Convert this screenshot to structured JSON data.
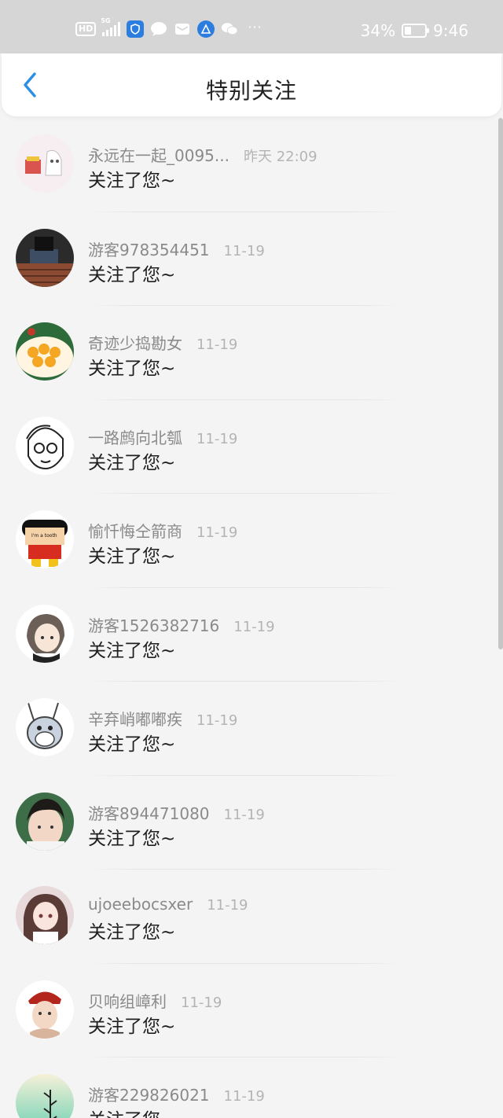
{
  "status_bar": {
    "hd": "HD",
    "network": "5G",
    "battery_percent": "34%",
    "battery_level": 0.34,
    "time": "9:46",
    "more": "···"
  },
  "header": {
    "title": "特别关注"
  },
  "colors": {
    "accent": "#2b8fe6",
    "status_bar_bg": "#d6d6d6"
  },
  "items": [
    {
      "name": "永远在一起_0095...",
      "time": "昨天 22:09",
      "action": "关注了您~"
    },
    {
      "name": "游客978354451",
      "time": "11-19",
      "action": "关注了您~"
    },
    {
      "name": "奇迹少捣勘女",
      "time": "11-19",
      "action": "关注了您~"
    },
    {
      "name": "一路鹧向北瓠",
      "time": "11-19",
      "action": "关注了您~"
    },
    {
      "name": "愉忏悔仝箭商",
      "time": "11-19",
      "action": "关注了您~"
    },
    {
      "name": "游客1526382716",
      "time": "11-19",
      "action": "关注了您~"
    },
    {
      "name": "辛弃峭嘟嘟疾",
      "time": "11-19",
      "action": "关注了您~"
    },
    {
      "name": "游客894471080",
      "time": "11-19",
      "action": "关注了您~"
    },
    {
      "name": "ujoeebocsxer",
      "time": "11-19",
      "action": "关注了您~"
    },
    {
      "name": "贝响组嶂利",
      "time": "11-19",
      "action": "关注了您~"
    },
    {
      "name": "游客229826021",
      "time": "11-19",
      "action": "关注了您~"
    }
  ]
}
